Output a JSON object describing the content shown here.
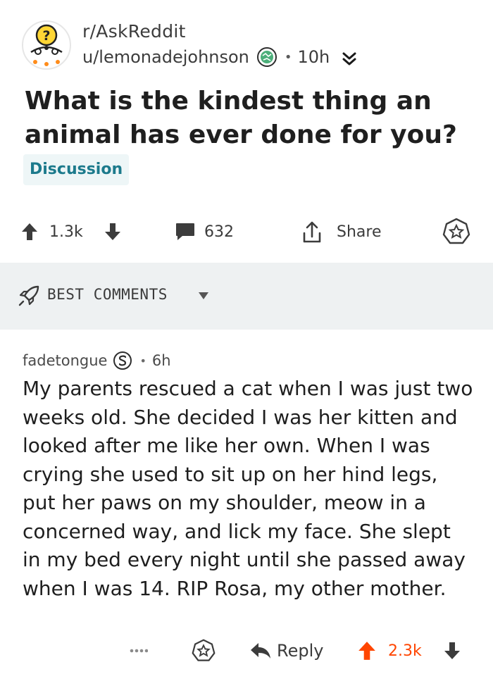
{
  "post": {
    "subreddit": "r/AskReddit",
    "author": "u/lemonadejohnson",
    "age": "10h",
    "title": "What is the kindest thing an animal has ever done for you?",
    "flair": "Discussion",
    "flair_color": "#1c7a8c",
    "upvotes": "1.3k",
    "comment_count": "632",
    "share_label": "Share"
  },
  "icons": {
    "subreddit_avatar": "askreddit-avatar-icon",
    "author_flair": "globe-flair-icon",
    "expand": "double-chevron-down-icon",
    "upvote": "arrow-up-icon",
    "downvote": "arrow-down-icon",
    "comments": "comment-bubble-icon",
    "share": "share-icon",
    "award": "award-star-icon",
    "sort": "rocket-icon",
    "more": "more-dots-icon",
    "reply": "reply-arrow-icon"
  },
  "sort": {
    "label": "BEST COMMENTS"
  },
  "comment": {
    "author": "fadetongue",
    "age": "6h",
    "body": "My parents rescued a cat when I was just two weeks old. She decided I was her kitten and looked after me like her own. When I was crying she used to sit up on her hind legs, put her paws on my shoulder, meow in a concerned way, and lick my face. She slept in my bed every night until she passed away when I was 14. RIP Rosa, my other mother.",
    "reply_label": "Reply",
    "score": "2.3k",
    "score_color": "#ff4500"
  }
}
